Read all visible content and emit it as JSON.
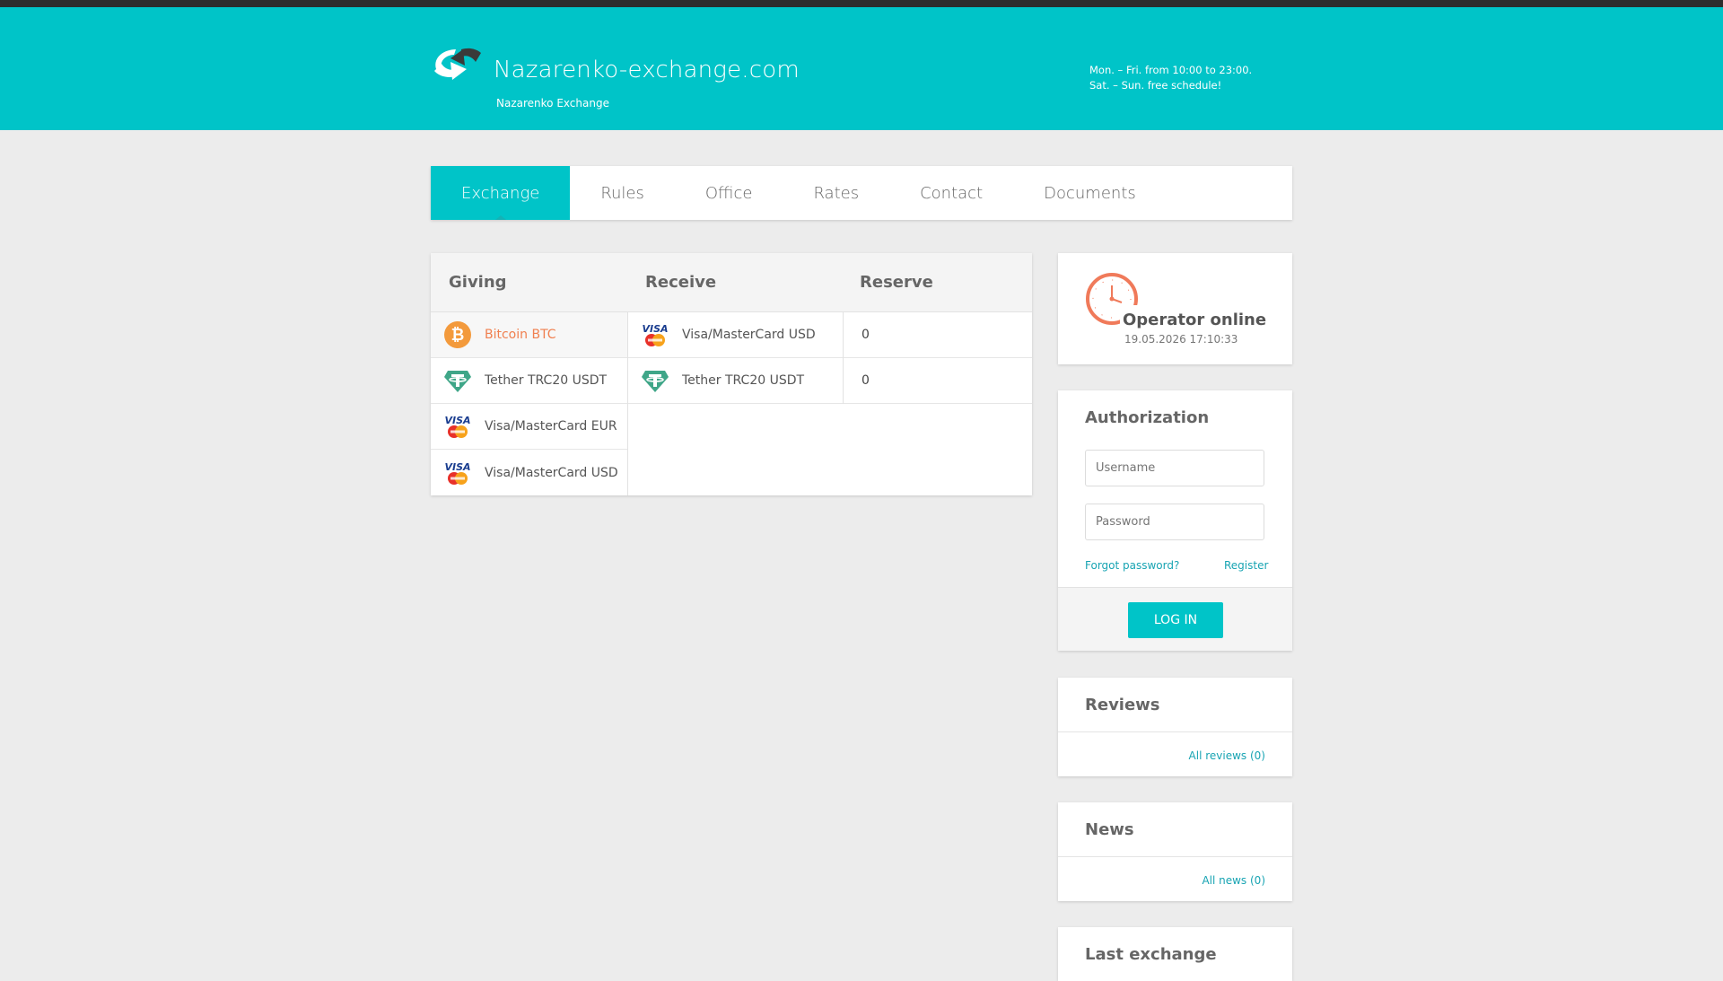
{
  "header": {
    "site_title": "Nazarenko-exchange.com",
    "site_subtitle": "Nazarenko Exchange",
    "hours_line1": "Mon. – Fri. from 10:00 to 23:00.",
    "hours_line2": "Sat. – Sun. free schedule!"
  },
  "nav": {
    "items": [
      "Exchange",
      "Rules",
      "Office",
      "Rates",
      "Contact",
      "Documents"
    ],
    "active": "Exchange"
  },
  "table": {
    "headers": [
      "Giving",
      "Receive",
      "Reserve"
    ],
    "giving": [
      {
        "label": "Bitcoin BTC",
        "icon": "bitcoin-icon",
        "selected": true
      },
      {
        "label": "Tether TRC20 USDT",
        "icon": "tether-icon",
        "selected": false
      },
      {
        "label": "Visa/MasterCard EUR",
        "icon": "visa-mastercard-icon",
        "selected": false
      },
      {
        "label": "Visa/MasterCard USD",
        "icon": "visa-mastercard-icon",
        "selected": false
      }
    ],
    "receive": [
      {
        "label": "Visa/MasterCard USD",
        "icon": "visa-mastercard-icon",
        "reserve": "0"
      },
      {
        "label": "Tether TRC20 USDT",
        "icon": "tether-icon",
        "reserve": "0"
      }
    ]
  },
  "operator": {
    "status": "Operator online",
    "timestamp": "19.05.2026 17:10:33"
  },
  "auth": {
    "title": "Authorization",
    "username_placeholder": "Username",
    "password_placeholder": "Password",
    "forgot": "Forgot password?",
    "register": "Register",
    "login": "LOG IN"
  },
  "reviews": {
    "title": "Reviews",
    "link": "All reviews (0)"
  },
  "news": {
    "title": "News",
    "link": "All news (0)"
  },
  "last_exchange": {
    "title": "Last exchange"
  },
  "colors": {
    "accent": "#00c4c8",
    "highlight": "#f08050",
    "link": "#18a4b3"
  }
}
